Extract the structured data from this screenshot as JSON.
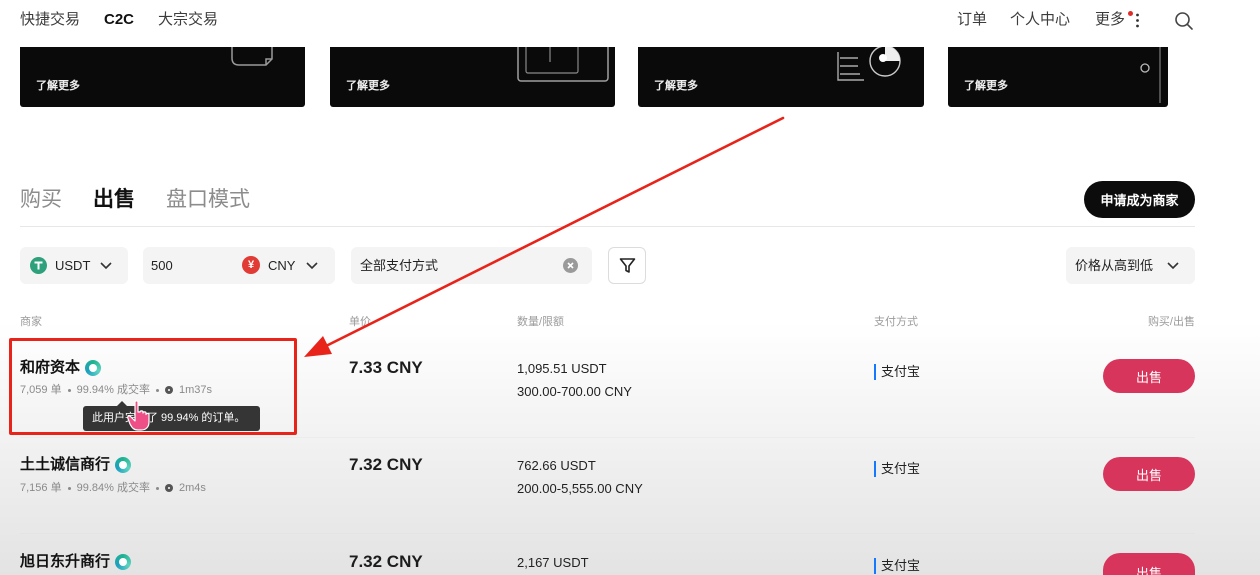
{
  "nav": {
    "links": [
      "快捷交易",
      "C2C",
      "大宗交易"
    ],
    "orders": "订单",
    "profile": "个人中心",
    "more": "更多",
    "icons": [
      "more-dots-icon",
      "search-icon"
    ]
  },
  "banners": [
    {
      "cta": "了解更多"
    },
    {
      "cta": "了解更多"
    },
    {
      "cta": "了解更多"
    },
    {
      "cta": "了解更多"
    }
  ],
  "tabs": [
    "购买",
    "出售",
    "盘口模式"
  ],
  "active_tab_index": 1,
  "apply_merchant_label": "申请成为商家",
  "filters": {
    "crypto": {
      "value": "USDT",
      "icon": "tether-icon"
    },
    "amount": {
      "value": "500"
    },
    "fiat": {
      "value": "CNY",
      "symbol": "¥",
      "icon": "yuan-icon"
    },
    "payment": {
      "value": "全部支付方式",
      "icon": "clear-icon"
    },
    "filter_icon": "funnel-icon",
    "sort": {
      "value": "价格从高到低"
    }
  },
  "table": {
    "headers": {
      "merchant": "商家",
      "price": "单价",
      "amount": "数量/限额",
      "payment": "支付方式",
      "action": "购买/出售"
    },
    "rows": [
      {
        "name": "和府资本",
        "orders": "7,059 单",
        "completion": "99.94% 成交率",
        "release_time": "1m37s",
        "price": "7.33 CNY",
        "quantity": "1,095.51 USDT",
        "limit": "300.00-700.00 CNY",
        "payment": "支付宝",
        "action": "出售"
      },
      {
        "name": "土土诚信商行",
        "orders": "7,156 单",
        "completion": "99.84% 成交率",
        "release_time": "2m4s",
        "price": "7.32 CNY",
        "quantity": "762.66 USDT",
        "limit": "200.00-5,555.00 CNY",
        "payment": "支付宝",
        "action": "出售"
      },
      {
        "name": "旭日东升商行",
        "price": "7.32 CNY",
        "quantity": "2,167 USDT",
        "payment": "支付宝",
        "action": "出售"
      }
    ],
    "icons": [
      "verified-badge-icon",
      "clock-icon"
    ]
  },
  "tooltip": "此用户完成了 99.94% 的订单。",
  "colors": {
    "sell_button": "#d8355c",
    "verified": "#1fb38f",
    "annotation": "#e8231a",
    "payment_bar": "#1677ff",
    "tether": "#2ea07b",
    "yuan": "#e03b34"
  }
}
